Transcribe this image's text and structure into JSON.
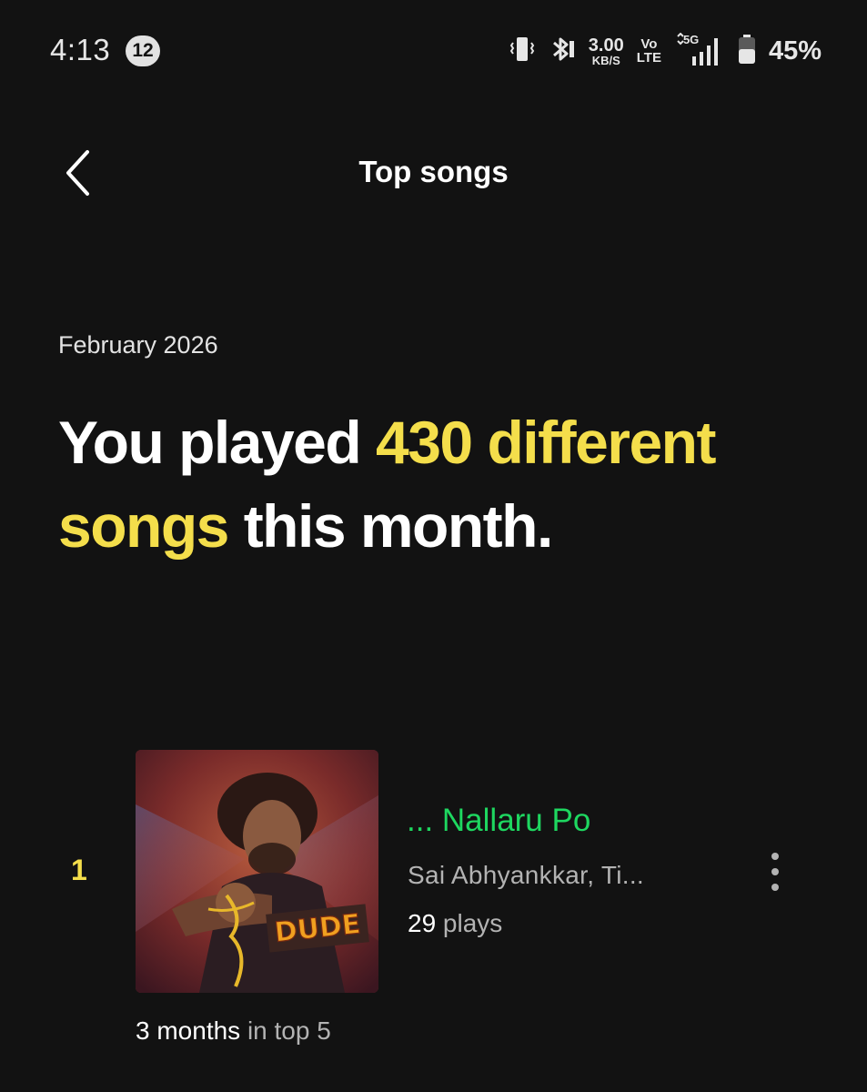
{
  "status_bar": {
    "time": "4:13",
    "notification_count": "12",
    "net_speed_value": "3.00",
    "net_speed_unit": "KB/S",
    "volte_top": "Vo",
    "volte_bottom": "LTE",
    "network_type": "5G",
    "battery_percent": "45%",
    "icons": [
      "vibrate-icon",
      "bluetooth-icon",
      "signal-icon",
      "battery-icon"
    ]
  },
  "header": {
    "title": "Top songs",
    "back_icon": "chevron-left-icon"
  },
  "summary": {
    "month": "February 2026",
    "headline_prefix": "You played ",
    "headline_highlight": "430 different songs",
    "headline_suffix": " this month."
  },
  "songs": [
    {
      "rank": "1",
      "title": "... Nallaru Po",
      "artists": "Sai Abhyankkar, Ti...",
      "plays_count": "29",
      "plays_label": " plays",
      "streak_value": "3 months",
      "streak_label": " in top 5",
      "album_art_text": "DUDE"
    }
  ],
  "colors": {
    "background": "#121212",
    "highlight_yellow": "#f4de4b",
    "spotify_green": "#1ed760",
    "secondary_text": "#b3b3b3"
  }
}
